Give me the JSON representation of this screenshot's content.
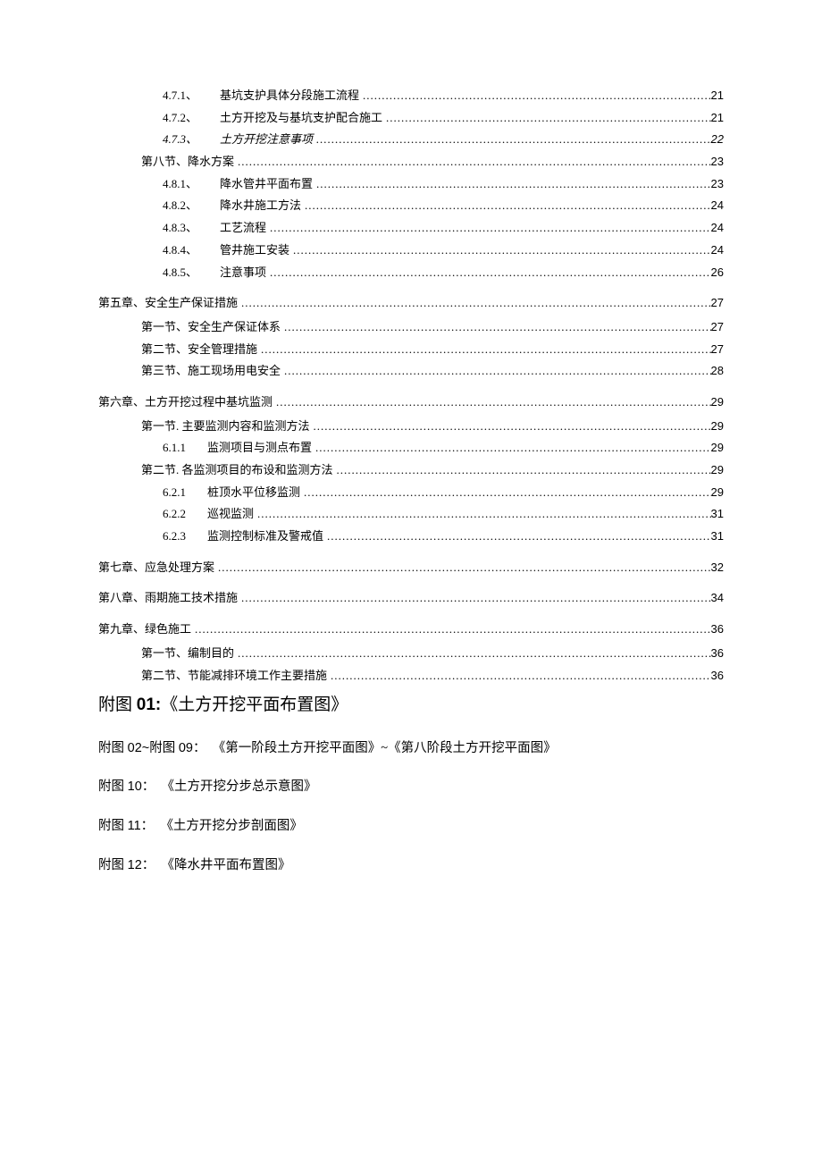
{
  "toc": [
    {
      "indent": 3,
      "numClass": "num-wide",
      "number": "4.7.1、",
      "label": "基坑支护具体分段施工流程",
      "page": "21",
      "spaced": false
    },
    {
      "indent": 3,
      "numClass": "num-wide",
      "number": "4.7.2、",
      "label": "土方开挖及与基坑支护配合施工",
      "page": "21",
      "spaced": false
    },
    {
      "indent": 3,
      "numClass": "num-wide",
      "number": "4.7.3、",
      "label": "土方开挖注意事项",
      "page": "22",
      "italic": true,
      "spaced": false
    },
    {
      "indent": 2,
      "number": "第八节、降水方案",
      "label": "",
      "page": "23",
      "spaced": false
    },
    {
      "indent": 3,
      "numClass": "num-wide",
      "number": "4.8.1、",
      "label": "降水管井平面布置",
      "page": "23",
      "spaced": false
    },
    {
      "indent": 3,
      "numClass": "num-wide",
      "number": "4.8.2、",
      "label": "降水井施工方法",
      "page": "24",
      "spaced": false
    },
    {
      "indent": 3,
      "numClass": "num-wide",
      "number": "4.8.3、",
      "label": "工艺流程",
      "page": "24",
      "spaced": false
    },
    {
      "indent": 3,
      "numClass": "num-wide",
      "number": "4.8.4、",
      "label": "管井施工安装",
      "page": "24",
      "spaced": false
    },
    {
      "indent": 3,
      "numClass": "num-wide",
      "number": "4.8.5、",
      "label": "注意事项",
      "page": "26",
      "spaced": false
    },
    {
      "indent": 1,
      "number": "第五章、安全生产保证措施",
      "label": "",
      "page": "27",
      "spaced": true
    },
    {
      "indent": 2,
      "number": "第一节、安全生产保证体系",
      "label": "",
      "page": "27",
      "spaced": false
    },
    {
      "indent": 2,
      "number": "第二节、安全管理措施",
      "label": "",
      "page": "27",
      "spaced": false
    },
    {
      "indent": 2,
      "number": "第三节、施工现场用电安全",
      "label": "",
      "page": "28",
      "spaced": false
    },
    {
      "indent": 1,
      "number": "第六章、土方开挖过程中基坑监测",
      "label": "",
      "page": "29",
      "spaced": true
    },
    {
      "indent": 2,
      "number": "第一节. 主要监测内容和监测方法",
      "label": "",
      "page": "29",
      "spaced": false
    },
    {
      "indent": 3,
      "numClass": "num-mid",
      "number": "6.1.1",
      "label": "监测项目与测点布置",
      "page": "29",
      "spaced": false
    },
    {
      "indent": 2,
      "number": "第二节. 各监测项目的布设和监测方法",
      "label": "",
      "page": "29",
      "spaced": false
    },
    {
      "indent": 3,
      "numClass": "num-mid",
      "number": "6.2.1",
      "label": "桩顶水平位移监测",
      "page": "29",
      "spaced": false
    },
    {
      "indent": 3,
      "numClass": "num-mid",
      "number": "6.2.2",
      "label": "巡视监测",
      "page": "31",
      "spaced": false
    },
    {
      "indent": 3,
      "numClass": "num-mid",
      "number": "6.2.3",
      "label": "监测控制标准及警戒值",
      "page": "31",
      "spaced": false
    },
    {
      "indent": 1,
      "number": "第七章、应急处理方案",
      "label": "",
      "page": "32",
      "spaced": true
    },
    {
      "indent": 1,
      "number": "第八章、雨期施工技术措施",
      "label": "",
      "page": "34",
      "spaced": true
    },
    {
      "indent": 1,
      "number": "第九章、绿色施工",
      "label": "",
      "page": "36",
      "spaced": true
    },
    {
      "indent": 2,
      "number": "第一节、编制目的",
      "label": "",
      "page": "36",
      "spaced": false
    },
    {
      "indent": 2,
      "number": "第二节、节能减排环境工作主要措施",
      "label": "",
      "page": "36",
      "spaced": false
    }
  ],
  "appendix": {
    "title_prefix": "附图",
    "title_num": "01:",
    "title_text": "《土方开挖平面布置图》",
    "lines": [
      {
        "prefix": "附图",
        "num": "02~",
        "prefix2": "附图",
        "num2": "09：",
        "text": "《第一阶段土方开挖平面图》~《第八阶段土方开挖平面图》"
      },
      {
        "prefix": "附图",
        "num": "10：",
        "text": "《土方开挖分步总示意图》"
      },
      {
        "prefix": "附图",
        "num": "11：",
        "text": "《土方开挖分步剖面图》"
      },
      {
        "prefix": "附图",
        "num": "12：",
        "text": "《降水井平面布置图》"
      }
    ]
  }
}
